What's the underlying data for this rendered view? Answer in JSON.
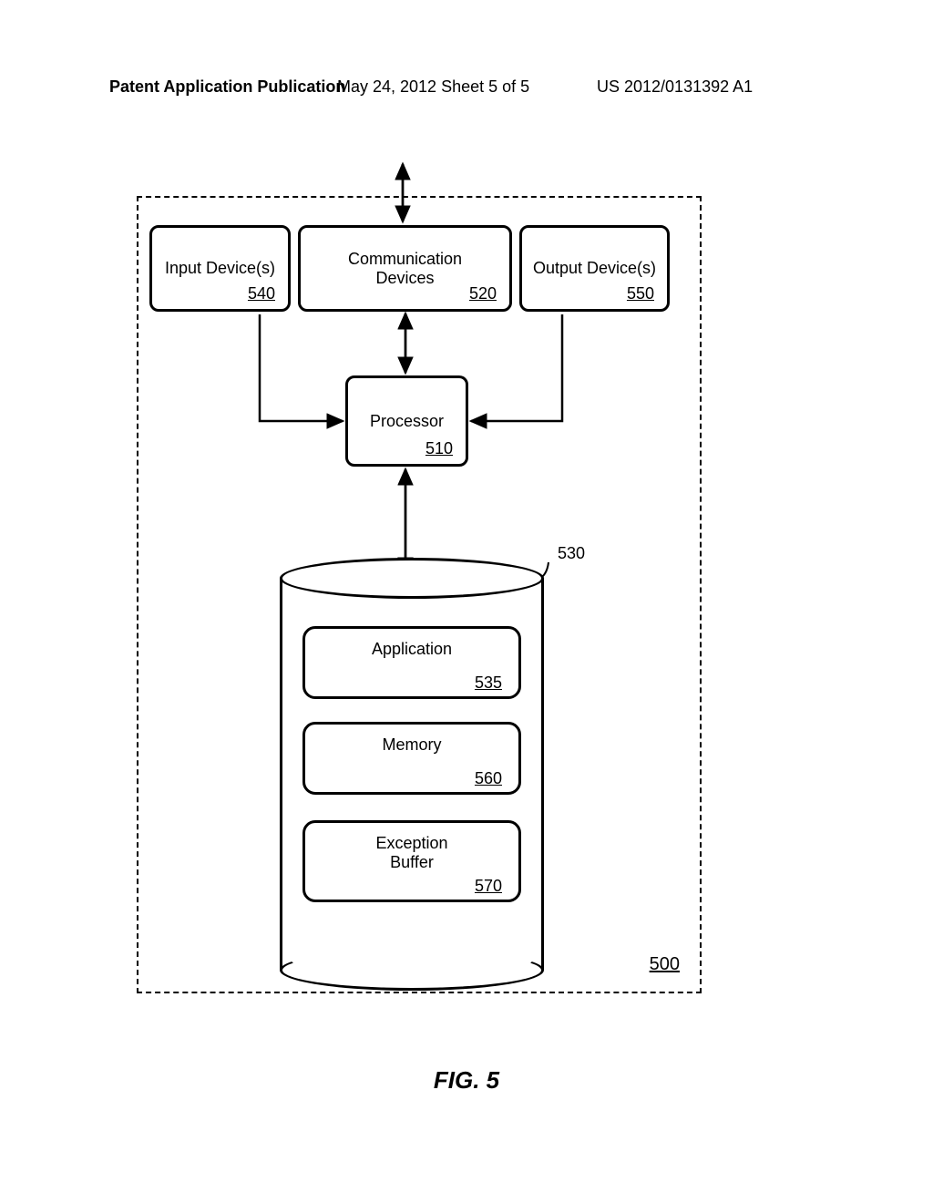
{
  "header": {
    "left": "Patent Application Publication",
    "center": "May 24, 2012  Sheet 5 of 5",
    "right": "US 2012/0131392 A1"
  },
  "boxes": {
    "input": {
      "label": "Input Device(s)",
      "ref": "540"
    },
    "comm": {
      "label1": "Communication",
      "label2": "Devices",
      "ref": "520"
    },
    "output": {
      "label": "Output Device(s)",
      "ref": "550"
    },
    "processor": {
      "label": "Processor",
      "ref": "510"
    },
    "application": {
      "label": "Application",
      "ref": "535"
    },
    "memory": {
      "label": "Memory",
      "ref": "560"
    },
    "exception": {
      "label1": "Exception",
      "label2": "Buffer",
      "ref": "570"
    }
  },
  "storage_ref": "530",
  "system_ref": "500",
  "figure_label": "FIG. 5"
}
